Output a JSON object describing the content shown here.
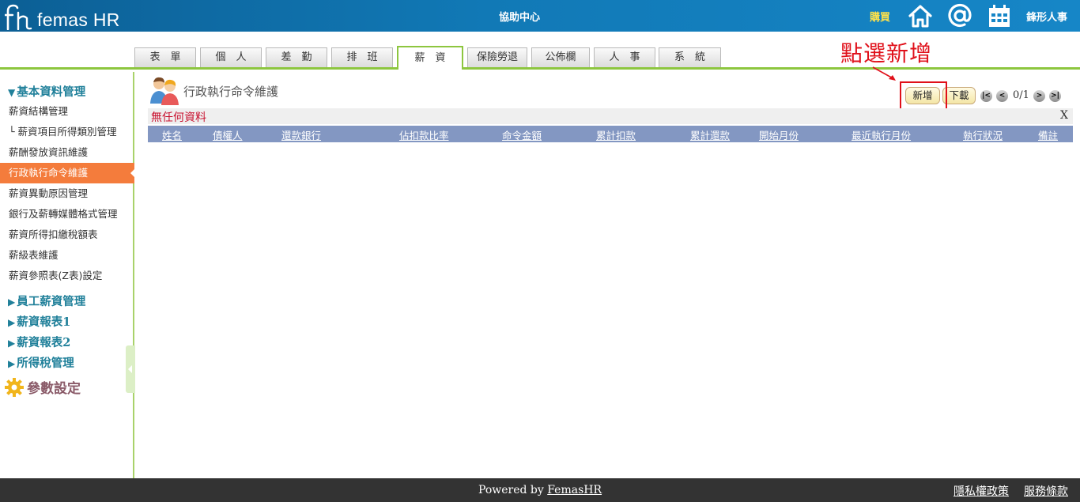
{
  "header": {
    "logo_text": "femas HR",
    "help_center": "協助中心",
    "buy": "購買",
    "company": "鋒形人事",
    "icons": [
      "home-icon",
      "at-icon",
      "calendar-icon"
    ],
    "colors": {
      "bar": "#1179b6",
      "buy": "#ffe24a"
    }
  },
  "tabs": [
    {
      "label": "表　單",
      "active": false
    },
    {
      "label": "個　人",
      "active": false
    },
    {
      "label": "差　勤",
      "active": false
    },
    {
      "label": "排　班",
      "active": false
    },
    {
      "label": "薪　資",
      "active": true
    },
    {
      "label": "保險勞退",
      "active": false
    },
    {
      "label": "公佈欄",
      "active": false
    },
    {
      "label": "人　事",
      "active": false
    },
    {
      "label": "系　統",
      "active": false
    }
  ],
  "annotation": "點選新增",
  "sidebar": {
    "section_basic": "基本資料管理",
    "items": [
      "薪資結構管理",
      "└ 薪資項目所得類別管理",
      "薪酬發放資訊維護",
      "行政執行命令維護",
      "薪資異動原因管理",
      "銀行及薪轉媒體格式管理",
      "薪資所得扣繳稅額表",
      "薪級表維護",
      "薪資參照表(Z表)設定"
    ],
    "active_index": 3,
    "sections": [
      "員工薪資管理",
      "薪資報表1",
      "薪資報表2",
      "所得稅管理"
    ],
    "param": "參數設定"
  },
  "main": {
    "title": "行政執行命令維護",
    "add_button": "新增",
    "download_button": "下載",
    "pager": {
      "first": "|<",
      "prev": "<",
      "info": "0/1",
      "next": ">",
      "last": ">|"
    },
    "message": "無任何資料",
    "close": "X",
    "columns": [
      "姓名",
      "債權人",
      "還款銀行",
      "佔扣款比率",
      "命令金額",
      "累計扣款",
      "累計還款",
      "開始月份",
      "最近執行月份",
      "執行狀況",
      "備註"
    ]
  },
  "footer": {
    "powered_prefix": "Powered by ",
    "powered_link": "FemasHR",
    "privacy": "隱私權政策",
    "terms": "服務條款"
  }
}
